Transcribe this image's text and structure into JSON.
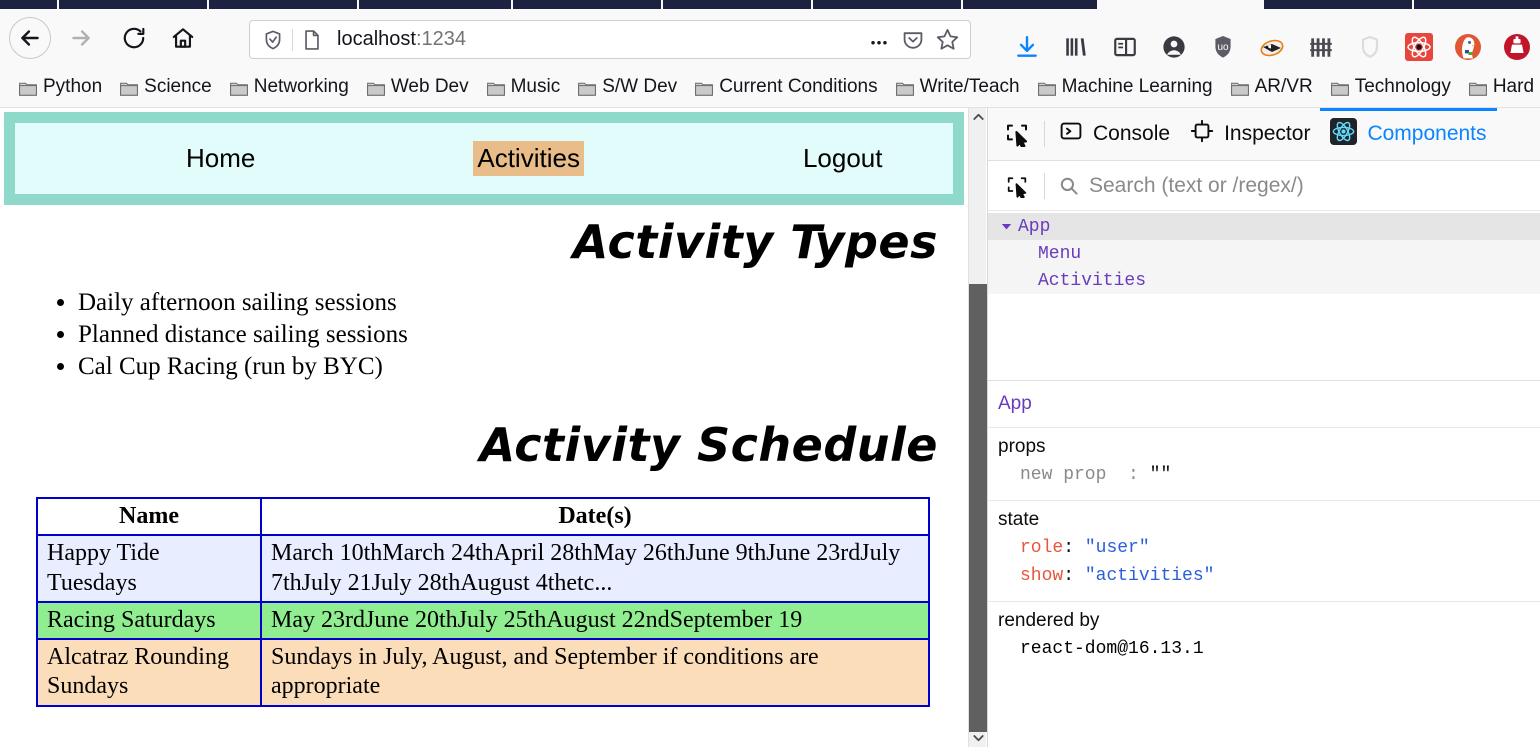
{
  "browser": {
    "url_host": "localhost",
    "url_port": ":1234",
    "nav": {
      "back": "Back",
      "forward": "Forward",
      "reload": "Reload",
      "home": "Home"
    },
    "urlbar": {
      "shield_label": "Tracking protection",
      "page_label": "Page info",
      "more_label": "Page actions",
      "pocket_label": "Save to Pocket",
      "bookmark_label": "Bookmark this page"
    },
    "toolbar_icons": [
      "downloads-icon",
      "library-icon",
      "sidebars-icon",
      "account-icon",
      "ublock-icon",
      "badger-icon",
      "fences-icon",
      "shield-outline-icon",
      "react-devtools-icon",
      "duckduckgo-icon",
      "cleaner-icon"
    ],
    "bookmarks": [
      "Python",
      "Science",
      "Networking",
      "Web Dev",
      "Music",
      "S/W Dev",
      "Current Conditions",
      "Write/Teach",
      "Machine Learning",
      "AR/VR",
      "Technology",
      "Hard"
    ]
  },
  "page": {
    "menu": {
      "home": "Home",
      "activities": "Activities",
      "logout": "Logout"
    },
    "headings": {
      "types": "Activity Types",
      "schedule": "Activity Schedule"
    },
    "activity_types": [
      "Daily afternoon sailing sessions",
      "Planned distance sailing sessions",
      "Cal Cup Racing (run by BYC)"
    ],
    "schedule": {
      "columns": [
        "Name",
        "Date(s)"
      ],
      "rows": [
        {
          "name": "Happy Tide Tuesdays",
          "dates": "March 10thMarch 24thApril 28thMay 26thJune 9thJune 23rdJuly 7thJuly 21July 28thAugust 4thetc..."
        },
        {
          "name": "Racing Saturdays",
          "dates": "May 23rdJune 20thJuly 25thAugust 22ndSeptember 19"
        },
        {
          "name": "Alcatraz Rounding Sundays",
          "dates": "Sundays in July, August, and September if conditions are appropriate"
        }
      ]
    },
    "colors": {
      "menu_border": "#8fd9cb",
      "menu_bg": "#e2fcfc",
      "active_link_bg": "#e8bd8a",
      "table_border": "#0000cc",
      "row0_bg": "#e8eeff",
      "row1_bg": "#90ee90",
      "row2_bg": "#fcddb9"
    }
  },
  "devtools": {
    "tabs": [
      {
        "label": "Console",
        "icon": "console-icon",
        "active": false
      },
      {
        "label": "Inspector",
        "icon": "inspector-icon",
        "active": false
      },
      {
        "label": "Components",
        "icon": "react-icon",
        "active": true
      }
    ],
    "search_placeholder": "Search (text or /regex/)",
    "tree": [
      {
        "label": "App",
        "depth": 0,
        "expanded": true,
        "selected": true
      },
      {
        "label": "Menu",
        "depth": 1,
        "expanded": false,
        "selected": false
      },
      {
        "label": "Activities",
        "depth": 1,
        "expanded": false,
        "selected": false
      }
    ],
    "selected_component": "App",
    "props": {
      "title": "props",
      "entries": [
        {
          "key": "new prop",
          "sep": ":",
          "value": "\"\""
        }
      ]
    },
    "state": {
      "title": "state",
      "entries": [
        {
          "key": "role",
          "sep": ":",
          "value": "\"user\""
        },
        {
          "key": "show",
          "sep": ":",
          "value": "\"activities\""
        }
      ]
    },
    "rendered_by": {
      "title": "rendered by",
      "value": "react-dom@16.13.1"
    },
    "accent": "#0a84ff"
  }
}
